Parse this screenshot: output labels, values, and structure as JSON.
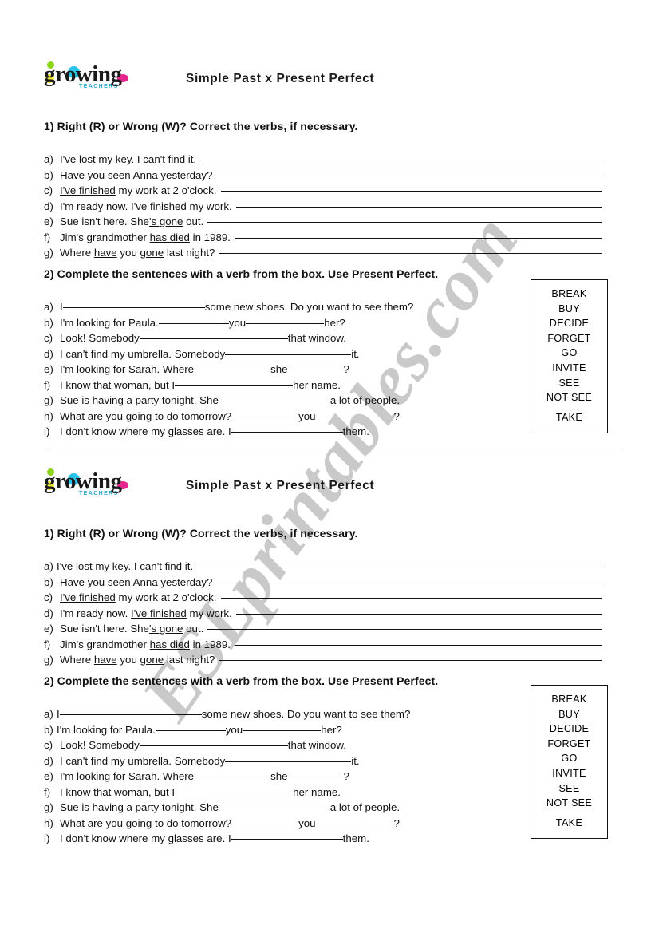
{
  "watermark": "ESLprintables.com",
  "logo": {
    "word": "growing",
    "subtext": "TEACHERS",
    "colors": {
      "green": "#8dd41c",
      "yellow": "#f2ee3a",
      "cyan": "#29c5e8",
      "pink": "#e5268f",
      "subtext": "#2aa9cf"
    }
  },
  "title": "Simple Past x Present Perfect",
  "exercise1": {
    "heading_top": "1)   Right (R) or Wrong (W)? Correct the verbs, if necessary.",
    "heading_bottom": "1) Right (R) or Wrong (W)? Correct the verbs, if necessary.",
    "items_top": [
      {
        "label": "a)",
        "pre": "I've ",
        "u": "lost",
        "post": " my key. I can't find it."
      },
      {
        "label": "b)",
        "pre": "",
        "u": "Have you seen",
        "post": " Anna yesterday?"
      },
      {
        "label": "c)",
        "pre": "",
        "u": "I've finished",
        "post": " my work at 2 o'clock."
      },
      {
        "label": "d)",
        "pre": "I'm ready now. I've finished my work.",
        "u": "",
        "post": ""
      },
      {
        "label": "e)",
        "pre": "Sue isn't here. She",
        "u": "'s gone",
        "post": " out."
      },
      {
        "label": "f)",
        "pre": "Jim's grandmother ",
        "u": "has died",
        "post": " in 1989."
      },
      {
        "label": "g)",
        "pre": "Where ",
        "u": "have",
        "post": " you gone last night?",
        "u2": "gone"
      }
    ],
    "items_bottom": [
      {
        "label": "a)",
        "pre": "I've lost my key. I can't find it.",
        "u": "",
        "post": ""
      },
      {
        "label": "b)",
        "pre": "",
        "u": "Have you seen",
        "post": " Anna yesterday?"
      },
      {
        "label": "c)",
        "pre": "",
        "u": "I've finished",
        "post": " my work at 2 o'clock."
      },
      {
        "label": "d)",
        "pre": "I'm ready now. ",
        "u": "I've finished",
        "post": " my work."
      },
      {
        "label": "e)",
        "pre": "Sue isn't here. She",
        "u": "'s gone",
        "post": " out."
      },
      {
        "label": "f)",
        "pre": "Jim's grandmother ",
        "u": "has died",
        "post": " in 1989."
      },
      {
        "label": "g)",
        "pre": "Where ",
        "u": "have",
        "post": " you gone last night?",
        "u2": "gone"
      }
    ]
  },
  "exercise2": {
    "heading_top": "2)  Complete the sentences with a verb from the box. Use Present Perfect.",
    "heading_bottom": "2) Complete the sentences with a verb from the box. Use Present Perfect.",
    "items": [
      {
        "label": "a)",
        "parts": [
          "I ",
          " some new shoes. Do you want to see them?"
        ],
        "blanks": [
          178
        ]
      },
      {
        "label": "b)",
        "parts": [
          "I'm looking for Paula. ",
          " you ",
          " her?"
        ],
        "blanks": [
          88,
          98
        ]
      },
      {
        "label": "c)",
        "parts": [
          "Look! Somebody ",
          " that window."
        ],
        "blanks": [
          186
        ]
      },
      {
        "label": "d)",
        "parts": [
          "I can't find my umbrella. Somebody ",
          " it."
        ],
        "blanks": [
          158
        ]
      },
      {
        "label": "e)",
        "parts": [
          "I'm looking for Sarah. Where ",
          " she ",
          "?"
        ],
        "blanks": [
          96,
          70
        ]
      },
      {
        "label": "f)",
        "parts": [
          "I know that woman, but I ",
          " her name."
        ],
        "blanks": [
          148
        ]
      },
      {
        "label": "g)",
        "parts": [
          "Sue is having a party tonight. She ",
          " a lot of people."
        ],
        "blanks": [
          140
        ]
      },
      {
        "label": "h)",
        "parts": [
          "What are you going to do tomorrow? ",
          " you ",
          "?"
        ],
        "blanks": [
          84,
          98
        ]
      },
      {
        "label": "i)",
        "parts": [
          "I don't know where my glasses are. I ",
          " them."
        ],
        "blanks": [
          140
        ]
      }
    ],
    "wordbox": [
      "BREAK",
      "BUY",
      "DECIDE",
      "FORGET",
      "GO",
      "INVITE",
      "SEE",
      "NOT SEE",
      "TAKE"
    ]
  }
}
